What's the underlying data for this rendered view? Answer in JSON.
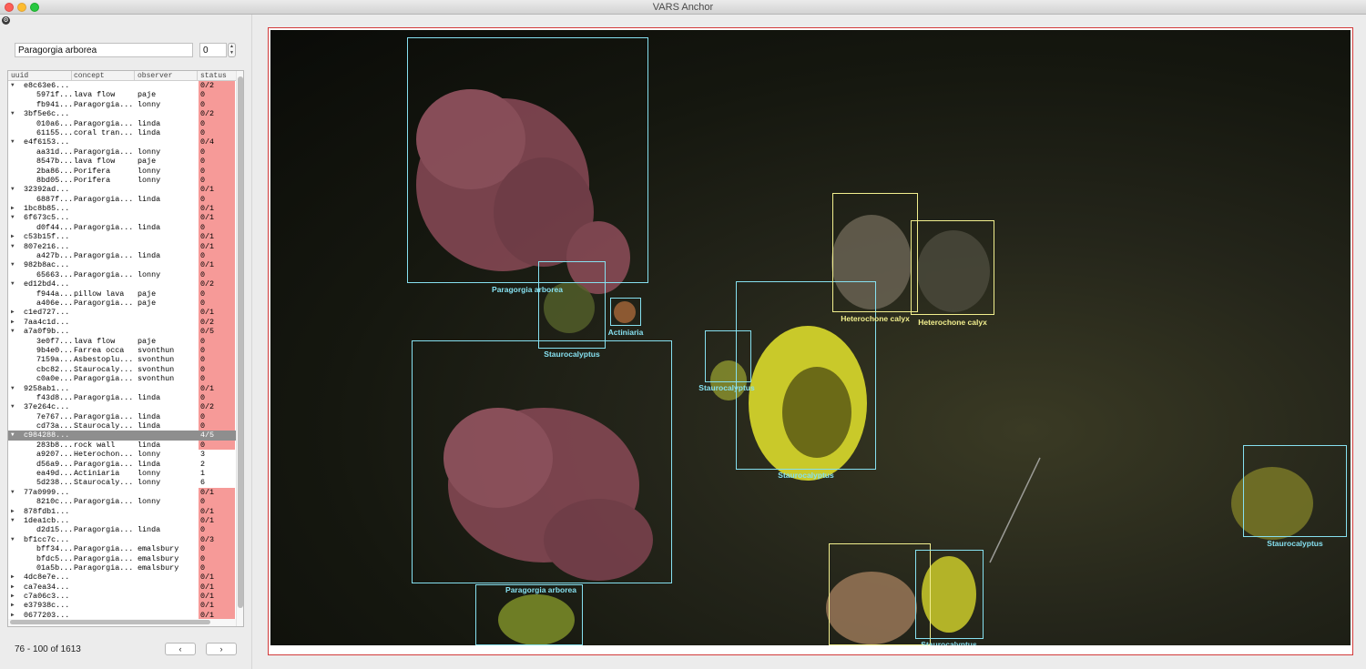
{
  "window": {
    "title": "VARS Anchor"
  },
  "search": {
    "concept": "Paragorgia arborea",
    "index": "0"
  },
  "table": {
    "headers": {
      "uid": "uuid",
      "concept": "concept",
      "observer": "observer",
      "status": "status"
    },
    "rows": [
      {
        "type": "group",
        "uid": "e8c63e6...",
        "status": "0/2"
      },
      {
        "type": "child",
        "uid": "5971f...",
        "concept": "lava flow",
        "observer": "paje",
        "status": "0"
      },
      {
        "type": "child",
        "uid": "fb941...",
        "concept": "Paragorgia...",
        "observer": "lonny",
        "status": "0"
      },
      {
        "type": "group",
        "uid": "3bf5e6c...",
        "status": "0/2"
      },
      {
        "type": "child",
        "uid": "010a6...",
        "concept": "Paragorgia...",
        "observer": "linda",
        "status": "0"
      },
      {
        "type": "child",
        "uid": "61155...",
        "concept": "coral tran...",
        "observer": "linda",
        "status": "0"
      },
      {
        "type": "group",
        "uid": "e4f6153...",
        "status": "0/4"
      },
      {
        "type": "child",
        "uid": "aa31d...",
        "concept": "Paragorgia...",
        "observer": "lonny",
        "status": "0"
      },
      {
        "type": "child",
        "uid": "8547b...",
        "concept": "lava flow",
        "observer": "paje",
        "status": "0"
      },
      {
        "type": "child",
        "uid": "2ba86...",
        "concept": "Porifera",
        "observer": "lonny",
        "status": "0"
      },
      {
        "type": "child",
        "uid": "8bd05...",
        "concept": "Porifera",
        "observer": "lonny",
        "status": "0"
      },
      {
        "type": "group",
        "uid": "32392ad...",
        "status": "0/1"
      },
      {
        "type": "child",
        "uid": "6887f...",
        "concept": "Paragorgia...",
        "observer": "linda",
        "status": "0"
      },
      {
        "type": "collapsed",
        "uid": "1bc8b85...",
        "status": "0/1"
      },
      {
        "type": "group",
        "uid": "6f673c5...",
        "status": "0/1"
      },
      {
        "type": "child",
        "uid": "d0f44...",
        "concept": "Paragorgia...",
        "observer": "linda",
        "status": "0"
      },
      {
        "type": "collapsed",
        "uid": "c53b15f...",
        "status": "0/1"
      },
      {
        "type": "group",
        "uid": "807e216...",
        "status": "0/1"
      },
      {
        "type": "child",
        "uid": "a427b...",
        "concept": "Paragorgia...",
        "observer": "linda",
        "status": "0"
      },
      {
        "type": "group",
        "uid": "982b8ac...",
        "status": "0/1"
      },
      {
        "type": "child",
        "uid": "65663...",
        "concept": "Paragorgia...",
        "observer": "lonny",
        "status": "0"
      },
      {
        "type": "group",
        "uid": "ed12bd4...",
        "status": "0/2"
      },
      {
        "type": "child",
        "uid": "f944a...",
        "concept": "pillow lava",
        "observer": "paje",
        "status": "0"
      },
      {
        "type": "child",
        "uid": "a406e...",
        "concept": "Paragorgia...",
        "observer": "paje",
        "status": "0"
      },
      {
        "type": "collapsed",
        "uid": "c1ed727...",
        "status": "0/1"
      },
      {
        "type": "collapsed",
        "uid": "7aa4c1d...",
        "status": "0/2"
      },
      {
        "type": "group",
        "uid": "a7a0f9b...",
        "status": "0/5"
      },
      {
        "type": "child",
        "uid": "3e0f7...",
        "concept": "lava flow",
        "observer": "paje",
        "status": "0"
      },
      {
        "type": "child",
        "uid": "9b4e0...",
        "concept": "Farrea occa",
        "observer": "svonthun",
        "status": "0"
      },
      {
        "type": "child",
        "uid": "7159a...",
        "concept": "Asbestoplu...",
        "observer": "svonthun",
        "status": "0"
      },
      {
        "type": "child",
        "uid": "cbc82...",
        "concept": "Staurocaly...",
        "observer": "svonthun",
        "status": "0"
      },
      {
        "type": "child",
        "uid": "c0a0e...",
        "concept": "Paragorgia...",
        "observer": "svonthun",
        "status": "0"
      },
      {
        "type": "group",
        "uid": "9258ab1...",
        "status": "0/1"
      },
      {
        "type": "child",
        "uid": "f43d8...",
        "concept": "Paragorgia...",
        "observer": "linda",
        "status": "0"
      },
      {
        "type": "group",
        "uid": "37e264c...",
        "status": "0/2"
      },
      {
        "type": "child",
        "uid": "7e767...",
        "concept": "Paragorgia...",
        "observer": "linda",
        "status": "0"
      },
      {
        "type": "child",
        "uid": "cd73a...",
        "concept": "Staurocaly...",
        "observer": "linda",
        "status": "0"
      },
      {
        "type": "selected",
        "uid": "c984288...",
        "status": "4/5"
      },
      {
        "type": "child",
        "uid": "283b8...",
        "concept": "rock wall",
        "observer": "linda",
        "status": "0",
        "bad": true
      },
      {
        "type": "child",
        "uid": "a9207...",
        "concept": "Heterochon...",
        "observer": "lonny",
        "status": "3",
        "bad": false
      },
      {
        "type": "child",
        "uid": "d56a9...",
        "concept": "Paragorgia...",
        "observer": "linda",
        "status": "2",
        "bad": false
      },
      {
        "type": "child",
        "uid": "ea49d...",
        "concept": "Actiniaria",
        "observer": "lonny",
        "status": "1",
        "bad": false
      },
      {
        "type": "child",
        "uid": "5d238...",
        "concept": "Staurocaly...",
        "observer": "lonny",
        "status": "6",
        "bad": false
      },
      {
        "type": "group",
        "uid": "77a0999...",
        "status": "0/1"
      },
      {
        "type": "child",
        "uid": "8210c...",
        "concept": "Paragorgia...",
        "observer": "lonny",
        "status": "0"
      },
      {
        "type": "collapsed",
        "uid": "878fdb1...",
        "status": "0/1"
      },
      {
        "type": "group",
        "uid": "1dea1cb...",
        "status": "0/1"
      },
      {
        "type": "child",
        "uid": "d2d15...",
        "concept": "Paragorgia...",
        "observer": "linda",
        "status": "0"
      },
      {
        "type": "group",
        "uid": "bf1cc7c...",
        "status": "0/3"
      },
      {
        "type": "child",
        "uid": "bff34...",
        "concept": "Paragorgia...",
        "observer": "emalsbury",
        "status": "0"
      },
      {
        "type": "child",
        "uid": "bfdc5...",
        "concept": "Paragorgia...",
        "observer": "emalsbury",
        "status": "0"
      },
      {
        "type": "child",
        "uid": "01a5b...",
        "concept": "Paragorgia...",
        "observer": "emalsbury",
        "status": "0"
      },
      {
        "type": "collapsed",
        "uid": "4dc8e7e...",
        "status": "0/1"
      },
      {
        "type": "collapsed",
        "uid": "ca7ea34...",
        "status": "0/1"
      },
      {
        "type": "collapsed",
        "uid": "c7a06c3...",
        "status": "0/1"
      },
      {
        "type": "collapsed",
        "uid": "e37938c...",
        "status": "0/1"
      },
      {
        "type": "collapsed",
        "uid": "0677203...",
        "status": "0/1"
      }
    ]
  },
  "pagination": {
    "range": "76 - 100 of 1613",
    "prev": "‹",
    "next": "›"
  },
  "annotations": [
    {
      "label": "Paragorgia arborea",
      "color": "cyan"
    },
    {
      "label": "Staurocalyptus",
      "color": "cyan"
    },
    {
      "label": "Actiniaria",
      "color": "cyan"
    },
    {
      "label": "Paragorgia arborea",
      "color": "cyan"
    },
    {
      "label": "Staurocalyptus",
      "color": "cyan"
    },
    {
      "label": "Staurocalyptus",
      "color": "cyan"
    },
    {
      "label": "Staurocalyptus",
      "color": "cyan"
    },
    {
      "label": "Heterochone calyx",
      "color": "yellow"
    },
    {
      "label": "Heterochone calyx",
      "color": "yellow"
    },
    {
      "label": "Staurocalyptus",
      "color": "cyan"
    },
    {
      "label": "Heterochone calyx",
      "color": "yellow"
    },
    {
      "label": "Staurocalyptus",
      "color": "cyan"
    }
  ],
  "colors": {
    "status_incomplete": "#f69a98",
    "selected_row": "#8e8e8e",
    "box_cyan": "#86e0f0",
    "box_yellow": "#f2ef8e"
  }
}
